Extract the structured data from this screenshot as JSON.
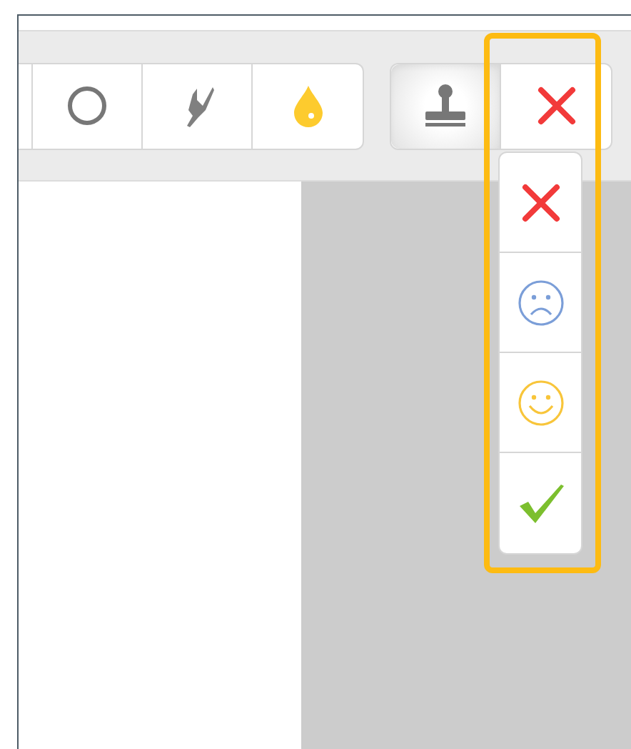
{
  "toolbar": {
    "tools": [
      {
        "kind": "circle"
      },
      {
        "kind": "highlighter"
      },
      {
        "kind": "color",
        "color": "#fdcb2e"
      }
    ],
    "stamp_group": [
      {
        "kind": "stamp",
        "selected": true
      },
      {
        "kind": "cross",
        "selected": false
      }
    ]
  },
  "stamp_menu": {
    "highlighted": true,
    "items": [
      {
        "kind": "cross"
      },
      {
        "kind": "sad"
      },
      {
        "kind": "smile"
      },
      {
        "kind": "check"
      }
    ]
  }
}
